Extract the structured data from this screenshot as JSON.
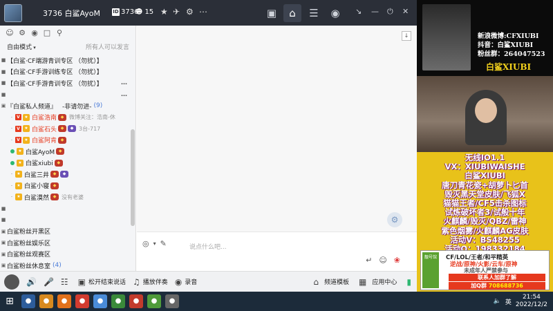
{
  "titlebar": {
    "channel_title": "3736 白鲨AyoM",
    "channel_id": "3736",
    "user_count": "15"
  },
  "left": {
    "mode": "自由模式",
    "mode_hint": "所有人可以发言",
    "tree": [
      {
        "kind": "group",
        "label": "【白鲨·CF端游青训专区 （勿扰）】"
      },
      {
        "kind": "group",
        "label": "【白鲨·CF手游训练专区 （勿扰）】"
      },
      {
        "kind": "group",
        "label": "【白鲨·CF手游青训专区 （勿扰）】"
      },
      {
        "kind": "spacer"
      },
      {
        "kind": "channel",
        "label": "『白鲨私人频道』",
        "tag": "-非请勿进-",
        "count": "(9)"
      },
      {
        "kind": "member",
        "name": "白鲨浩南",
        "note": "微博关注：浩南-休",
        "vip": true,
        "red": true
      },
      {
        "kind": "member",
        "name": "白鲨石头",
        "note": "3台-717",
        "vip": true,
        "red": true
      },
      {
        "kind": "member",
        "name": "白鲨阿肯",
        "note": "",
        "vip": true,
        "red": true
      },
      {
        "kind": "member",
        "name": "白鲨AyoM",
        "note": "",
        "vip": false,
        "online": true
      },
      {
        "kind": "member",
        "name": "白鲨xiubi",
        "note": "",
        "vip": false,
        "online": true
      },
      {
        "kind": "member",
        "name": "白鲨三井",
        "note": "",
        "vip": false
      },
      {
        "kind": "member",
        "name": "白鲨小寝",
        "note": "",
        "vip": false
      },
      {
        "kind": "member",
        "name": "白鲨漠然",
        "note": "没有老婆",
        "vip": false
      },
      {
        "kind": "spacer"
      },
      {
        "kind": "spacer"
      },
      {
        "kind": "group2",
        "label": "白鲨粉丝开黑区"
      },
      {
        "kind": "group2",
        "label": "白鲨粉丝娱乐区"
      },
      {
        "kind": "group2",
        "label": "白鲨粉丝观赛区"
      },
      {
        "kind": "group2",
        "label": "白鲨粉丝休息室",
        "count": "(4)"
      },
      {
        "kind": "group2",
        "label": "白鲨铁粉小窝"
      }
    ]
  },
  "compose": {
    "placeholder": "说点什么吧..."
  },
  "bottombar": {
    "mic_label": "松开结束说话",
    "play_label": "播放伴奏",
    "record_label": "录音",
    "template_label": "频道模板",
    "app_center_label": "应用中心"
  },
  "stream": {
    "weibo": "新浪微博:CFXIUBI",
    "douyin": "抖音：白鲨XIUBI",
    "fans": "粉丝群：264047523",
    "brand": "白鲨XIUBI",
    "promo_lines": [
      "无线IO1.1",
      "VX：XIUBIWAISHE",
      "白鲨XIUBI",
      "唐刀青花瓷+胡萝卜匕首",
      "毁灭黑天堂皮肤/飞狐X",
      "猫猫王者/CF5击杀图标",
      "试炼破坏者3/试般十年",
      "火麒麟/毁灭/QBZ/雷神",
      "紫色烟雾/火麒麟AG皮肤",
      "活动V：BS48255",
      "活动Q：198332184"
    ],
    "ad": {
      "badge": "靓号馆",
      "line1": "CF/LOL/王者/和平精英",
      "line2": "逆战/原神/火影/云车/原神",
      "line3": "未成年人严禁参与",
      "join": "联系人加群了解",
      "qq_label": "加Q群",
      "qq_number": "708688736"
    }
  },
  "taskbar": {
    "lang": "英",
    "time": "21:54",
    "date": "2022/12/2"
  }
}
